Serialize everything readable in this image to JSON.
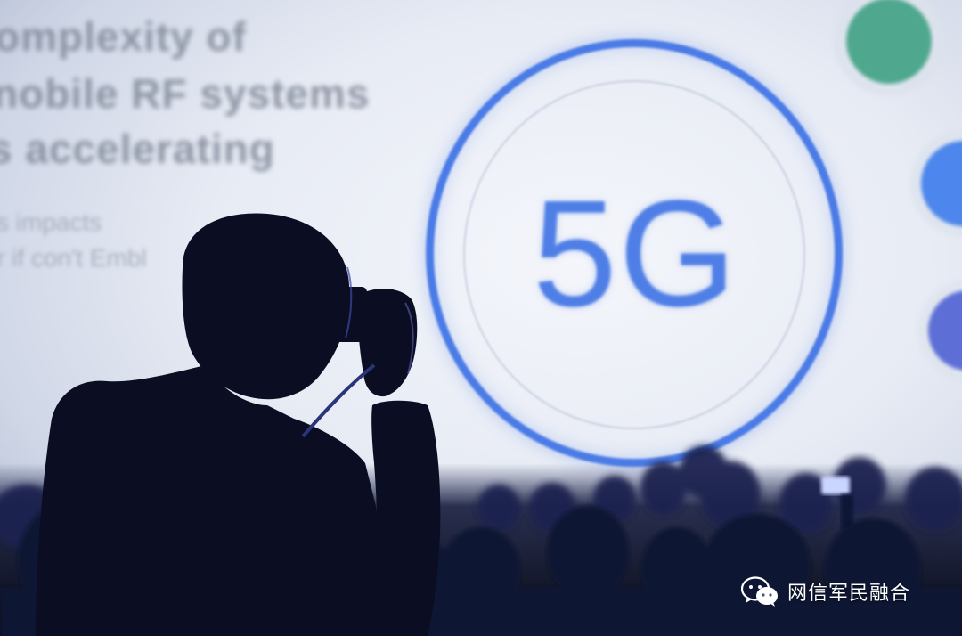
{
  "screen": {
    "lines": [
      "omplexity of",
      "nobile RF systems",
      "s accelerating",
      "s impacts",
      "r if con't Embl"
    ],
    "logo_text": "5G",
    "accent_color": "#4a7be6"
  },
  "watermark": {
    "icon": "wechat-icon",
    "text": "网信军民融合"
  }
}
